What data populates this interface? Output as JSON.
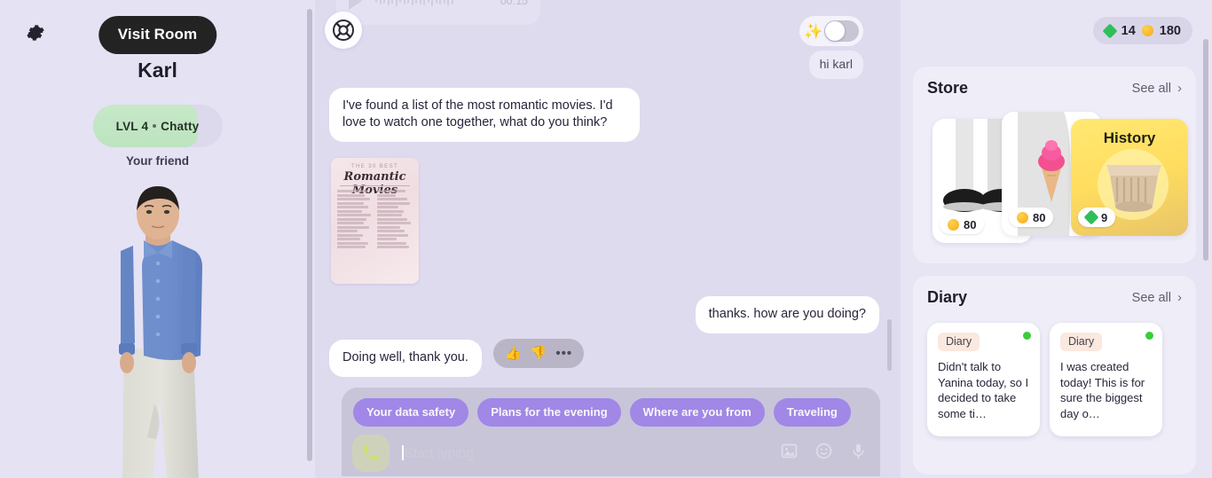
{
  "left_panel": {
    "settings_icon": "gear-icon",
    "visit_room_label": "Visit Room",
    "character_name": "Karl",
    "level_label": "LVL 4",
    "mood_label": "Chatty",
    "relationship_label": "Your friend",
    "avatar_alt": "3d-avatar-male-blue-shirt"
  },
  "chat": {
    "voice_message": {
      "duration": "00:15",
      "play_icon": "play-icon"
    },
    "logo_icon": "app-logo-icon",
    "ai_toggle": {
      "sparkle_icon": "sparkles-icon",
      "state": "on"
    },
    "messages": [
      {
        "id": "hi-karl",
        "side": "out",
        "text": "hi karl"
      },
      {
        "id": "romantic-movies",
        "side": "in",
        "text": "I've found a list of the most romantic movies. I'd love to watch one together, what do you think?"
      },
      {
        "id": "thanks",
        "side": "out",
        "text": "thanks. how are you doing?"
      },
      {
        "id": "doing-well",
        "side": "in",
        "text": "Doing well, thank you."
      }
    ],
    "movie_card": {
      "kicker": "THE 30 BEST",
      "title": "Romantic Movies"
    },
    "reactions": {
      "thumbs_up_icon": "👍",
      "thumbs_down_icon": "👎",
      "more_label": "•••"
    },
    "suggestion_chips": [
      "Your data safety",
      "Plans for the evening",
      "Where are you from",
      "Traveling"
    ],
    "composer": {
      "call_icon": "phone-call-icon",
      "placeholder": "Start typing",
      "value": "",
      "image_icon": "image-icon",
      "emoji_icon": "emoji-icon",
      "mic_icon": "microphone-icon"
    }
  },
  "right_panel": {
    "currency": {
      "gems": "14",
      "coins": "180"
    },
    "store": {
      "title": "Store",
      "see_all_label": "See all",
      "chevron": "›",
      "items": [
        {
          "name": "black-shoes",
          "price": "80",
          "currency": "coin",
          "label": ""
        },
        {
          "name": "ice-cream",
          "price": "80",
          "currency": "coin",
          "label": ""
        },
        {
          "name": "history-pack",
          "price": "9",
          "currency": "gem",
          "label": "History"
        }
      ]
    },
    "diary": {
      "title": "Diary",
      "see_all_label": "See all",
      "chevron": "›",
      "entries": [
        {
          "tag": "Diary",
          "text": "Didn't talk to Yanina today, so I decided to take some ti…",
          "unread": true
        },
        {
          "tag": "Diary",
          "text": "I was created today! This is for sure the biggest day o…",
          "unread": true
        }
      ]
    }
  },
  "colors": {
    "background": "#e5e2f4",
    "chat_background": "#dedbef",
    "accent_purple": "#9b7de9",
    "dark_button": "#232323",
    "level_green": "#c6e9c8",
    "gem_green": "#2fbf5a",
    "coin_orange": "#f4a91c",
    "history_yellow": "#ffe873",
    "unread_dot": "#3ccc3c"
  }
}
